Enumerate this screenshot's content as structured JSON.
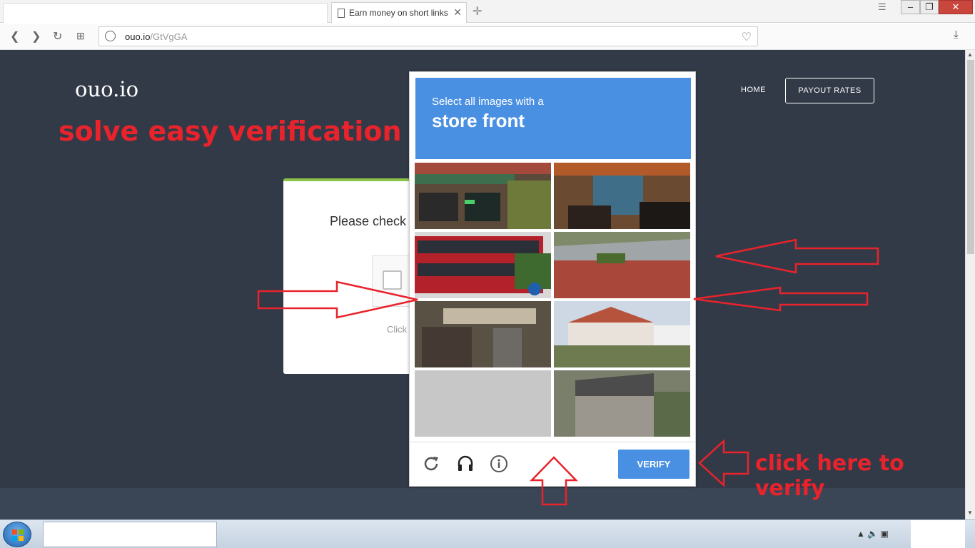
{
  "browser": {
    "tab_title": "Earn money on short links",
    "url_domain": "ouo.io",
    "url_path": "/GtVgGA"
  },
  "site": {
    "logo": "ouo.io",
    "nav_home": "HOME",
    "nav_payout": "PAYOUT RATES",
    "card_message": "Please check",
    "card_click": "Click"
  },
  "annotations": {
    "top_text": "solve easy verification",
    "verify_hint": "click here to verify",
    "color": "#e8232b"
  },
  "captcha": {
    "instruction": "Select all images with a",
    "target": "store front",
    "verify_label": "VERIFY",
    "header_color": "#4a90e2",
    "icons": [
      "reload-icon",
      "headphones-icon",
      "info-icon"
    ]
  }
}
